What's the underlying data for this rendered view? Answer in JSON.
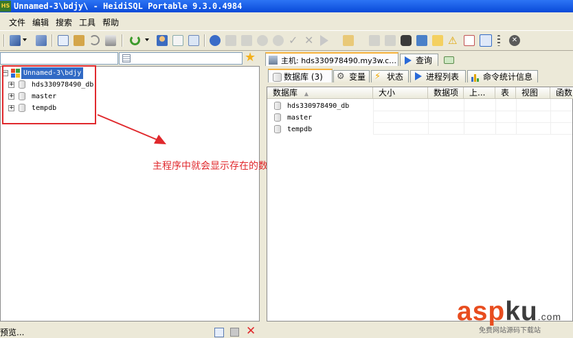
{
  "window": {
    "title": "Unnamed-3\\bdjy\\ - HeidiSQL Portable 9.3.0.4984",
    "app_icon_text": "HS"
  },
  "menu": [
    "文件",
    "编辑",
    "搜索",
    "工具",
    "帮助"
  ],
  "tree": {
    "root": "Unnamed-3\\bdjy",
    "databases": [
      "hds330978490_db",
      "master",
      "tempdb"
    ]
  },
  "annotation": "主程序中就会显示存在的数据库",
  "tabs_top": [
    {
      "label": "主机: hds330978490.my3w.c…",
      "icon": "host-icon"
    },
    {
      "label": "查询",
      "icon": "play-icon"
    }
  ],
  "tabs_sub": [
    {
      "label": "数据库 (3)",
      "icon": "database-icon"
    },
    {
      "label": "变量",
      "icon": "gear-icon"
    },
    {
      "label": "状态",
      "icon": "lightning-icon"
    },
    {
      "label": "进程列表",
      "icon": "play-icon"
    },
    {
      "label": "命令统计信息",
      "icon": "bar-chart-icon"
    }
  ],
  "grid": {
    "columns": [
      "数据库",
      "大小",
      "数据项",
      "上...",
      "表",
      "视图",
      "函数"
    ],
    "sort_indicator": "▲",
    "rows": [
      "hds330978490_db",
      "master",
      "tempdb"
    ]
  },
  "status": {
    "text": "预览..."
  },
  "watermark": {
    "main_a": "asp",
    "main_b": "ku",
    "suffix": ".com",
    "sub": "免费网站源码下载站"
  },
  "colors": {
    "titlebar": "#0a4ad8",
    "highlight": "#e0282c",
    "selection": "#316ac5",
    "active_tab": "#f7b23b"
  }
}
